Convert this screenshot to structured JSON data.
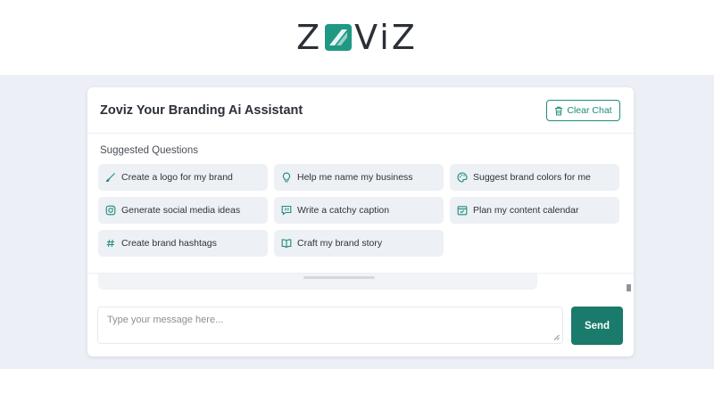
{
  "brand": {
    "logo_text": "ZOViZ",
    "accent_color": "#1a7a6c"
  },
  "header": {
    "title": "Zoviz Your Branding Ai Assistant",
    "clear_label": "Clear Chat",
    "clear_icon": "trash-icon"
  },
  "suggestions": {
    "label": "Suggested Questions",
    "items": [
      {
        "label": "Create a logo for my brand",
        "icon": "brush-icon"
      },
      {
        "label": "Help me name my business",
        "icon": "lightbulb-icon"
      },
      {
        "label": "Suggest brand colors for me",
        "icon": "palette-icon"
      },
      {
        "label": "Generate social media ideas",
        "icon": "instagram-icon"
      },
      {
        "label": "Write a catchy caption",
        "icon": "comment-quote-icon"
      },
      {
        "label": "Plan my content calendar",
        "icon": "calendar-check-icon"
      },
      {
        "label": "Create brand hashtags",
        "icon": "hashtag-icon"
      },
      {
        "label": "Craft my brand story",
        "icon": "book-icon"
      }
    ]
  },
  "composer": {
    "placeholder": "Type your message here...",
    "value": "",
    "send_label": "Send"
  }
}
